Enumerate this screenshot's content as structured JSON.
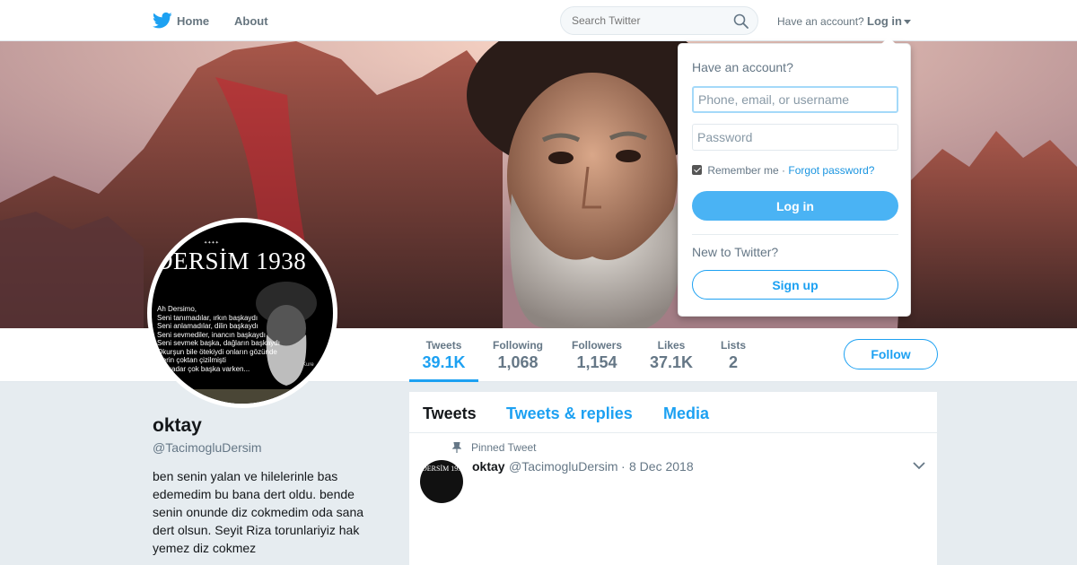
{
  "topbar": {
    "home_label": "Home",
    "about_label": "About",
    "search_placeholder": "Search Twitter",
    "have_account": "Have an account?",
    "login_label": "Log in"
  },
  "profile": {
    "name": "oktay",
    "handle": "@TacimogluDersim",
    "bio": "ben senin yalan ve hilelerinle bas edemedim bu bana dert oldu. bende senin onunde diz cokmedim oda sana dert olsun. Seyit Riza torunlariyiz hak yemez diz cokmez",
    "avatar": {
      "title": "DERSİM 1938",
      "poem": "Ah Dersimo,\nSeni tanımadılar, ırkın başkaydı\nSeni anlamadılar, dilin başkaydı\nSeni sevmediler, inancın başkaydı\nSeni sevmek başka, dağların başkaydı\nOkurşun bile ötekiydi onların gözünde\nDerin çoktan çizilmişti\nBu kadar çok başka varken...",
      "signature": "Kure"
    }
  },
  "stats": [
    {
      "label": "Tweets",
      "value": "39.1K",
      "active": true
    },
    {
      "label": "Following",
      "value": "1,068"
    },
    {
      "label": "Followers",
      "value": "1,154"
    },
    {
      "label": "Likes",
      "value": "37.1K"
    },
    {
      "label": "Lists",
      "value": "2"
    }
  ],
  "follow_label": "Follow",
  "timeline": {
    "tabs": [
      "Tweets",
      "Tweets & replies",
      "Media"
    ],
    "pinned_label": "Pinned Tweet",
    "tweet": {
      "name": "oktay",
      "handle": "@TacimogluDersim",
      "separator": "·",
      "date": "8 Dec 2018",
      "avatar_text": "DERSİM 1938"
    }
  },
  "login_dropdown": {
    "title": "Have an account?",
    "username_placeholder": "Phone, email, or username",
    "password_placeholder": "Password",
    "remember_label": "Remember me",
    "separator": "·",
    "forgot_label": "Forgot password?",
    "login_button": "Log in",
    "new_label": "New to Twitter?",
    "signup_button": "Sign up"
  },
  "colors": {
    "brand": "#1da1f2",
    "text": "#14171a",
    "muted": "#657786",
    "background": "#e6ecf0"
  }
}
